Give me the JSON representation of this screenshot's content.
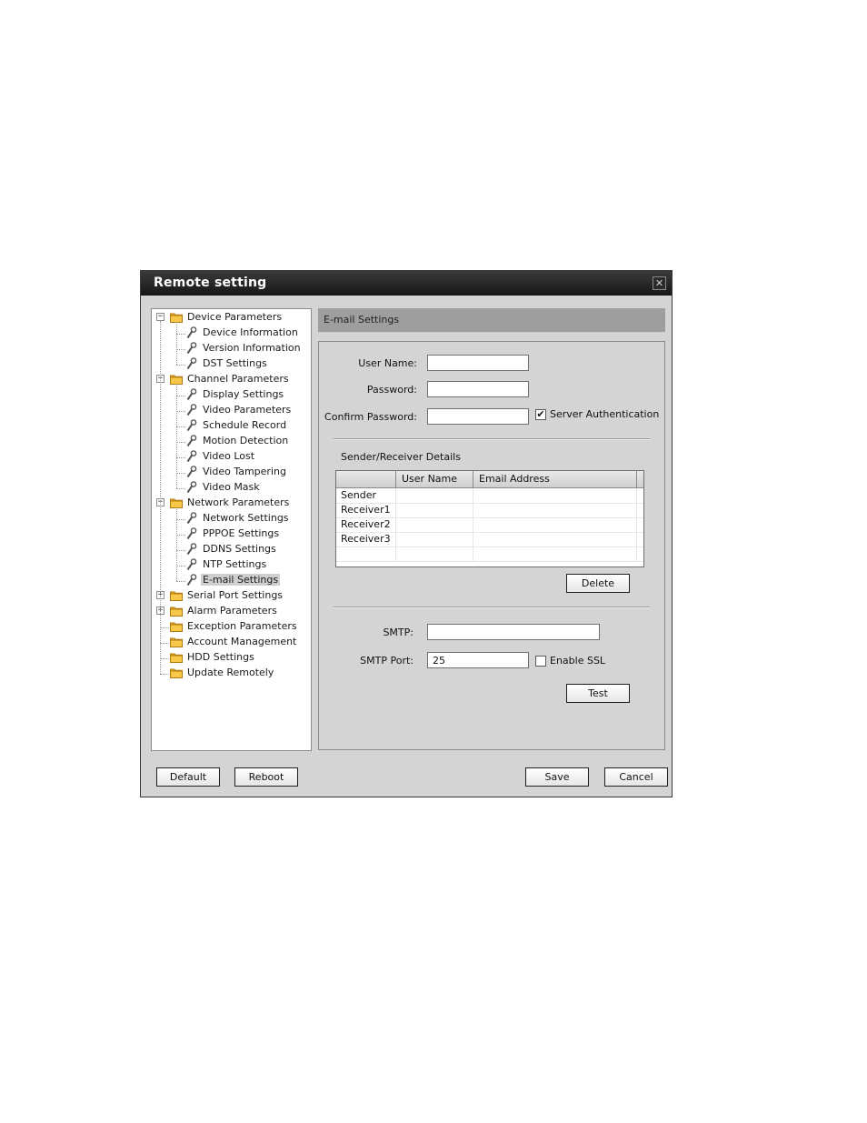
{
  "window": {
    "title": "Remote setting",
    "close_glyph": "✕"
  },
  "tree": {
    "groups": [
      {
        "label": "Device Parameters",
        "expander": "−",
        "children": [
          "Device Information",
          "Version Information",
          "DST Settings"
        ]
      },
      {
        "label": "Channel Parameters",
        "expander": "−",
        "children": [
          "Display Settings",
          "Video Parameters",
          "Schedule Record",
          "Motion Detection",
          "Video Lost",
          "Video Tampering",
          "Video Mask"
        ]
      },
      {
        "label": "Network Parameters",
        "expander": "−",
        "children": [
          "Network Settings",
          "PPPOE Settings",
          "DDNS Settings",
          "NTP Settings",
          "E-mail Settings"
        ]
      },
      {
        "label": "Serial Port Settings",
        "expander": "+",
        "children": []
      },
      {
        "label": "Alarm Parameters",
        "expander": "+",
        "children": []
      },
      {
        "label": "Exception Parameters",
        "expander": "",
        "children": []
      },
      {
        "label": "Account Management",
        "expander": "",
        "children": []
      },
      {
        "label": "HDD Settings",
        "expander": "",
        "children": []
      },
      {
        "label": "Update Remotely",
        "expander": "",
        "children": []
      }
    ],
    "selected": "E-mail Settings"
  },
  "email": {
    "header": "E-mail Settings",
    "user_name_label": "User Name:",
    "user_name_value": "",
    "password_label": "Password:",
    "password_value": "",
    "confirm_label": "Confirm Password:",
    "confirm_value": "",
    "server_auth_label": "Server Authentication",
    "server_auth_checked": true,
    "details_label": "Sender/Receiver Details",
    "table": {
      "columns": [
        "",
        "User Name",
        "Email Address"
      ],
      "rows": [
        [
          "Sender",
          "",
          ""
        ],
        [
          "Receiver1",
          "",
          ""
        ],
        [
          "Receiver2",
          "",
          ""
        ],
        [
          "Receiver3",
          "",
          ""
        ]
      ]
    },
    "delete_label": "Delete",
    "smtp_label": "SMTP:",
    "smtp_value": "",
    "smtp_port_label": "SMTP Port:",
    "smtp_port_value": "25",
    "ssl_label": "Enable SSL",
    "ssl_checked": false,
    "test_label": "Test"
  },
  "footer": {
    "default_label": "Default",
    "reboot_label": "Reboot",
    "save_label": "Save",
    "cancel_label": "Cancel"
  },
  "colors": {
    "titlebar": "#161616",
    "header": "#9e9e9e",
    "panel": "#d4d4d4",
    "folder": "#f0b020"
  },
  "icons": {
    "group": "folder-icon",
    "leaf": "wrench-icon"
  }
}
